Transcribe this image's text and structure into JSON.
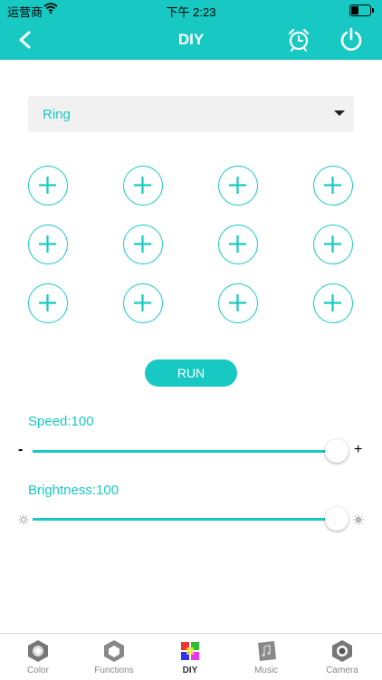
{
  "status_bar": {
    "carrier": "运营商",
    "time": "下午 2:23"
  },
  "nav": {
    "title": "DIY"
  },
  "mode_select": {
    "value": "Ring"
  },
  "run_button": {
    "label": "RUN"
  },
  "speed": {
    "label": "Speed:100",
    "value": 100,
    "min_label": "-",
    "max_label": "+"
  },
  "brightness": {
    "label": "Brightness:100",
    "value": 100
  },
  "tabs": [
    {
      "label": "Color",
      "icon": "color-icon"
    },
    {
      "label": "Functions",
      "icon": "functions-icon"
    },
    {
      "label": "DIY",
      "icon": "diy-icon",
      "active": true
    },
    {
      "label": "Music",
      "icon": "music-icon"
    },
    {
      "label": "Camera",
      "icon": "camera-icon"
    }
  ],
  "colors": {
    "accent": "#18c9c3",
    "background": "#ffffff",
    "dropdown_bg": "#f1f1f1"
  }
}
